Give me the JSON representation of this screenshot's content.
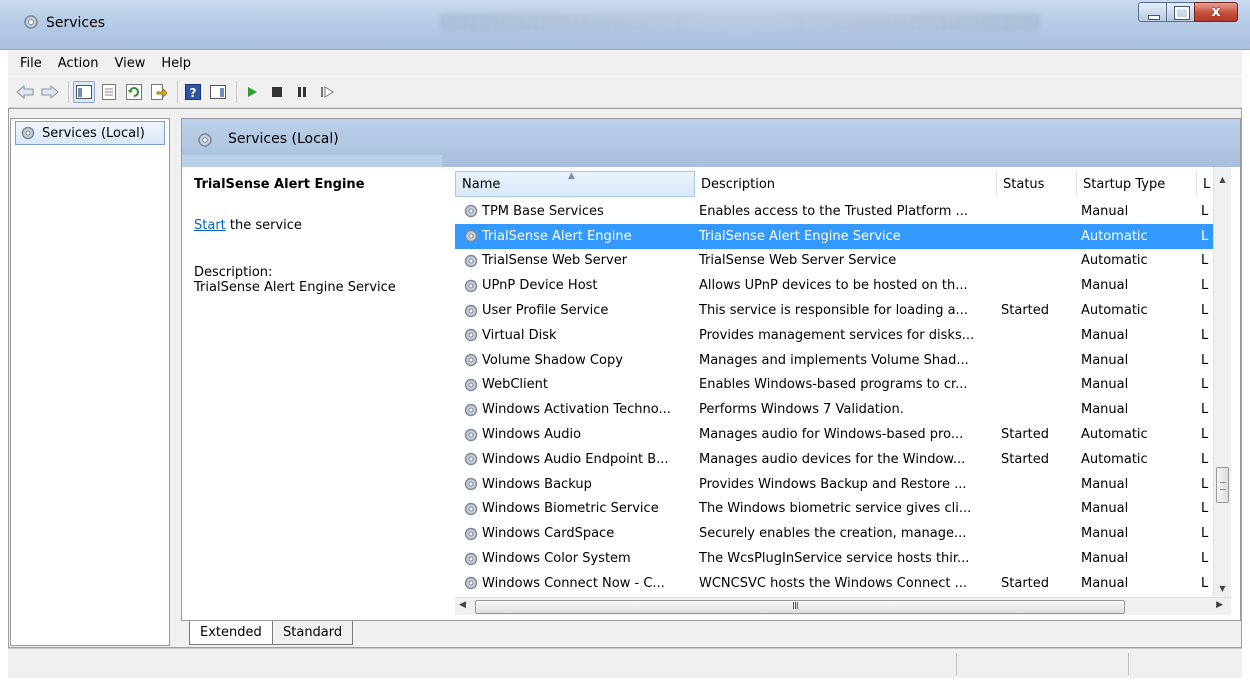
{
  "window": {
    "title": "Services",
    "close_label": "x"
  },
  "menu": [
    {
      "label": "File"
    },
    {
      "label": "Action"
    },
    {
      "label": "View"
    },
    {
      "label": "Help"
    }
  ],
  "toolbar": {
    "buttons": [
      "back-icon",
      "forward-icon",
      "show-hide-console-tree-icon",
      "properties-icon",
      "refresh-icon",
      "export-list-icon",
      "help-icon",
      "show-hide-action-pane-icon",
      "start-service-icon",
      "stop-service-icon",
      "pause-service-icon",
      "resume-service-icon"
    ]
  },
  "tree": {
    "root": "Services (Local)"
  },
  "pane": {
    "header": "Services (Local)"
  },
  "extended": {
    "service_name": "TrialSense Alert Engine",
    "start_link": "Start",
    "start_suffix": " the service",
    "description_label": "Description:",
    "description": "TrialSense Alert Engine Service"
  },
  "columns": [
    {
      "label": "Name"
    },
    {
      "label": "Description"
    },
    {
      "label": "Status"
    },
    {
      "label": "Startup Type"
    },
    {
      "label": "L"
    }
  ],
  "services": [
    {
      "name": "TPM Base Services",
      "description": "Enables access to the Trusted Platform ...",
      "status": "",
      "startup": "Manual",
      "logon": "L",
      "selected": false
    },
    {
      "name": "TrialSense Alert Engine",
      "description": "TrialSense Alert Engine Service",
      "status": "",
      "startup": "Automatic",
      "logon": "L",
      "selected": true
    },
    {
      "name": "TrialSense Web Server",
      "description": "TrialSense Web Server Service",
      "status": "",
      "startup": "Automatic",
      "logon": "L",
      "selected": false
    },
    {
      "name": "UPnP Device Host",
      "description": "Allows UPnP devices to be hosted on th...",
      "status": "",
      "startup": "Manual",
      "logon": "L",
      "selected": false
    },
    {
      "name": "User Profile Service",
      "description": "This service is responsible for loading a...",
      "status": "Started",
      "startup": "Automatic",
      "logon": "L",
      "selected": false
    },
    {
      "name": "Virtual Disk",
      "description": "Provides management services for disks...",
      "status": "",
      "startup": "Manual",
      "logon": "L",
      "selected": false
    },
    {
      "name": "Volume Shadow Copy",
      "description": "Manages and implements Volume Shad...",
      "status": "",
      "startup": "Manual",
      "logon": "L",
      "selected": false
    },
    {
      "name": "WebClient",
      "description": "Enables Windows-based programs to cr...",
      "status": "",
      "startup": "Manual",
      "logon": "L",
      "selected": false
    },
    {
      "name": "Windows Activation Techno...",
      "description": "Performs Windows 7 Validation.",
      "status": "",
      "startup": "Manual",
      "logon": "L",
      "selected": false
    },
    {
      "name": "Windows Audio",
      "description": "Manages audio for Windows-based pro...",
      "status": "Started",
      "startup": "Automatic",
      "logon": "L",
      "selected": false
    },
    {
      "name": "Windows Audio Endpoint B...",
      "description": "Manages audio devices for the Window...",
      "status": "Started",
      "startup": "Automatic",
      "logon": "L",
      "selected": false
    },
    {
      "name": "Windows Backup",
      "description": "Provides Windows Backup and Restore ...",
      "status": "",
      "startup": "Manual",
      "logon": "L",
      "selected": false
    },
    {
      "name": "Windows Biometric Service",
      "description": "The Windows biometric service gives cli...",
      "status": "",
      "startup": "Manual",
      "logon": "L",
      "selected": false
    },
    {
      "name": "Windows CardSpace",
      "description": "Securely enables the creation, manage...",
      "status": "",
      "startup": "Manual",
      "logon": "L",
      "selected": false
    },
    {
      "name": "Windows Color System",
      "description": "The WcsPlugInService service hosts thir...",
      "status": "",
      "startup": "Manual",
      "logon": "L",
      "selected": false
    },
    {
      "name": "Windows Connect Now - C...",
      "description": "WCNCSVC hosts the Windows Connect ...",
      "status": "Started",
      "startup": "Manual",
      "logon": "L",
      "selected": false
    }
  ],
  "hscroll": {
    "grip": "III"
  },
  "tabs": [
    {
      "label": "Extended"
    },
    {
      "label": "Standard"
    }
  ],
  "colors": {
    "selection": "#3399ff",
    "header_blue": "#a7bfdd",
    "link": "#0066cc"
  }
}
